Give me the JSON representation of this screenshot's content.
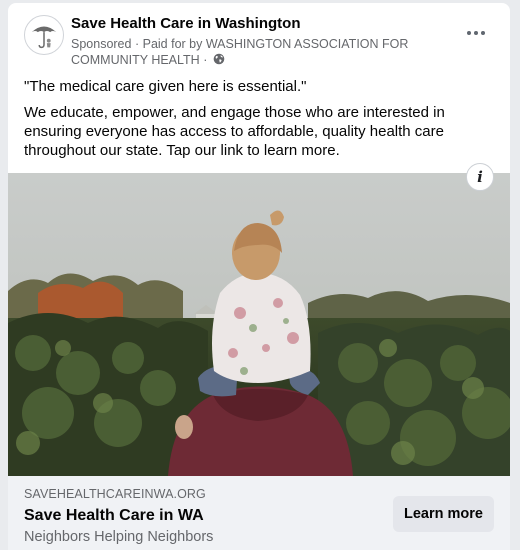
{
  "post": {
    "page_name": "Save Health Care in Washington",
    "sponsored_label": "Sponsored",
    "paid_for_text": "Paid for by WASHINGTON ASSOCIATION FOR COMMUNITY HEALTH",
    "separator": "·",
    "privacy_icon": "globe-icon",
    "avatar_icon": "umbrella-logo",
    "more_icon": "more-dots-icon"
  },
  "body": {
    "quote": "\"The medical care given here is essential.\"",
    "description": "We educate, empower, and engage those who are interested in ensuring everyone has access to affordable, quality health care throughout our state. Tap our link to learn more."
  },
  "image": {
    "info_label": "i"
  },
  "link": {
    "domain": "SAVEHEALTHCAREINWA.ORG",
    "title": "Save Health Care in WA",
    "description": "Neighbors Helping Neighbors",
    "cta_label": "Learn more"
  },
  "colors": {
    "page_bg": "#e9ebee",
    "card_bg": "#ffffff",
    "footer_bg": "#f0f2f5",
    "cta_bg": "#e4e6eb",
    "primary_text": "#050505",
    "secondary_text": "#65676b"
  }
}
